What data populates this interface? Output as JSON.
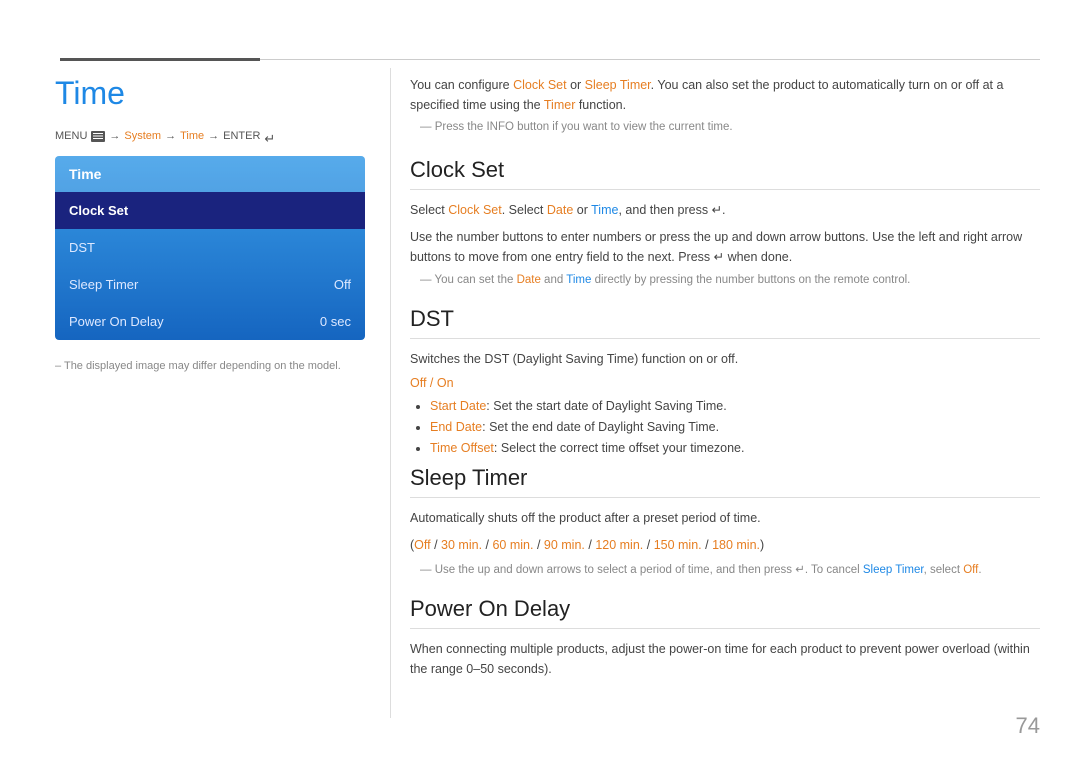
{
  "topLines": {},
  "leftPanel": {
    "title": "Time",
    "menuPath": {
      "menu": "MENU",
      "arrow1": "→",
      "system": "System",
      "arrow2": "→",
      "time": "Time",
      "arrow3": "→",
      "enter": "ENTER"
    },
    "menuBox": {
      "header": "Time",
      "items": [
        {
          "label": "Clock Set",
          "value": "",
          "selected": true
        },
        {
          "label": "DST",
          "value": "",
          "selected": false
        },
        {
          "label": "Sleep Timer",
          "value": "Off",
          "selected": false
        },
        {
          "label": "Power On Delay",
          "value": "0 sec",
          "selected": false
        }
      ]
    },
    "note": "– The displayed image may differ depending on the model."
  },
  "rightPanel": {
    "introText": "You can configure Clock Set or Sleep Timer. You can also set the product to automatically turn on or off at a specified time using the Timer function.",
    "introNote": "Press the INFO button if you want to view the current time.",
    "sections": [
      {
        "id": "clock-set",
        "title": "Clock Set",
        "body1": "Select Clock Set. Select Date or Time, and then press .",
        "body2": "Use the number buttons to enter numbers or press the up and down arrow buttons. Use the left and right arrow buttons to move from one entry field to the next. Press  when done.",
        "note": "You can set the Date and Time directly by pressing the number buttons on the remote control.",
        "highlights": []
      },
      {
        "id": "dst",
        "title": "DST",
        "body1": "Switches the DST (Daylight Saving Time) function on or off.",
        "dstStatus": "Off / On",
        "bullets": [
          "Start Date: Set the start date of Daylight Saving Time.",
          "End Date: Set the end date of Daylight Saving Time.",
          "Time Offset: Select the correct time offset your timezone."
        ]
      },
      {
        "id": "sleep-timer",
        "title": "Sleep Timer",
        "body1": "Automatically shuts off the product after a preset period of time.",
        "timerOptions": "(Off / 30 min. / 60 min. / 90 min. / 120 min. / 150 min. / 180 min.)",
        "note": "Use the up and down arrows to select a period of time, and then press . To cancel Sleep Timer, select Off."
      },
      {
        "id": "power-on-delay",
        "title": "Power On Delay",
        "body1": "When connecting multiple products, adjust the power-on time for each product to prevent power overload (within the range 0–50 seconds)."
      }
    ]
  },
  "pageNumber": "74"
}
